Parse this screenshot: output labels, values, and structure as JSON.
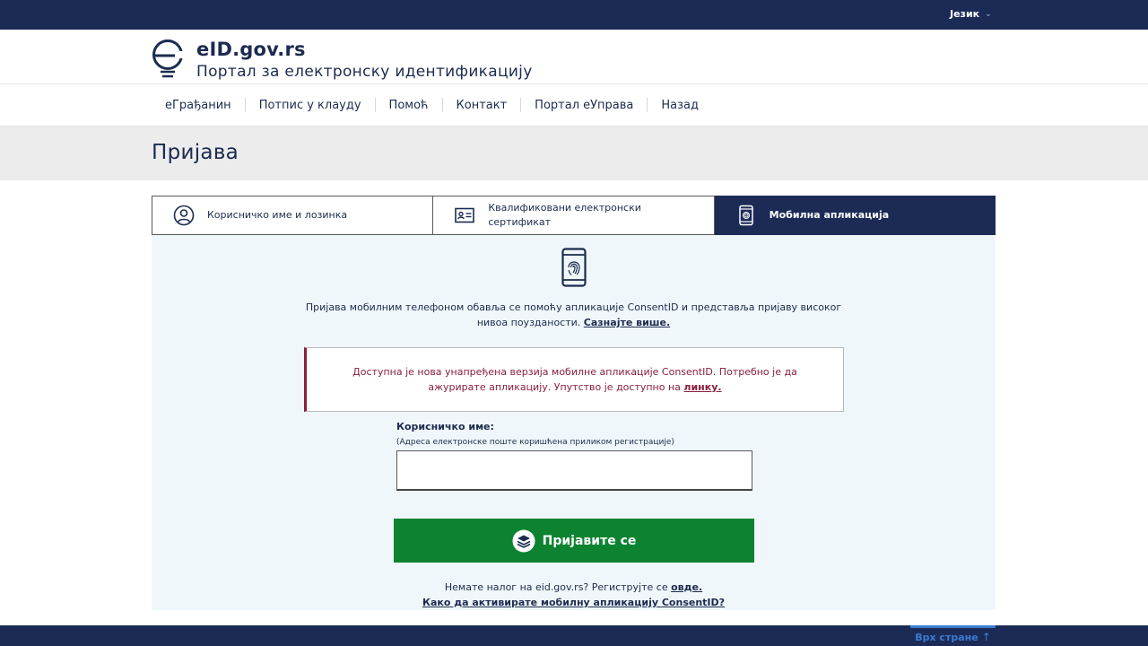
{
  "topbar": {
    "language_label": "Језик"
  },
  "header": {
    "site_name": "eID.gov.rs",
    "subtitle": "Портал за електронску идентификацију"
  },
  "nav": {
    "items": [
      {
        "label": "еГрађанин"
      },
      {
        "label": "Потпис у клауду"
      },
      {
        "label": "Помоћ"
      },
      {
        "label": "Контакт"
      },
      {
        "label": "Портал еУправа"
      },
      {
        "label": "Назад"
      }
    ]
  },
  "page": {
    "title": "Пријава"
  },
  "tabs": [
    {
      "label": "Корисничко име и лозинка",
      "icon": "user-circle-icon",
      "active": false
    },
    {
      "label": "Квалификовани електронски сертификат",
      "icon": "id-card-icon",
      "active": false
    },
    {
      "label": "Мобилна апликација",
      "icon": "mobile-fingerprint-icon",
      "active": true
    }
  ],
  "panel": {
    "intro_text": "Пријава мобилним телефоном обавља се помоћу апликације ConsentID и представља пријаву високог нивоа поузданости.",
    "intro_link": "Сазнајте више.",
    "alert_text": "Доступна је нова унапређена верзија мобилне апликације ConsentID. Потребно је да ажурирате апликацију. Упутство је доступно на",
    "alert_link": "линку.",
    "username_label": "Корисничко име:",
    "username_hint": "(Адреса електронске поште коришћена приликом регистрације)",
    "username_value": "",
    "login_button": "Пријавите се",
    "register_text": "Немате налог на eid.gov.rs? Региструјте се",
    "register_link": "овде.",
    "howto_link": "Како да активирате мобилну апликацију ConsentID?"
  },
  "footer": {
    "back_to_top": "Врх стране"
  },
  "colors": {
    "navy": "#1c2b56",
    "green": "#0d8331",
    "alert": "#8a1f3b",
    "panel_bg": "#f0f7fa",
    "link_blue": "#3a7bd5"
  }
}
